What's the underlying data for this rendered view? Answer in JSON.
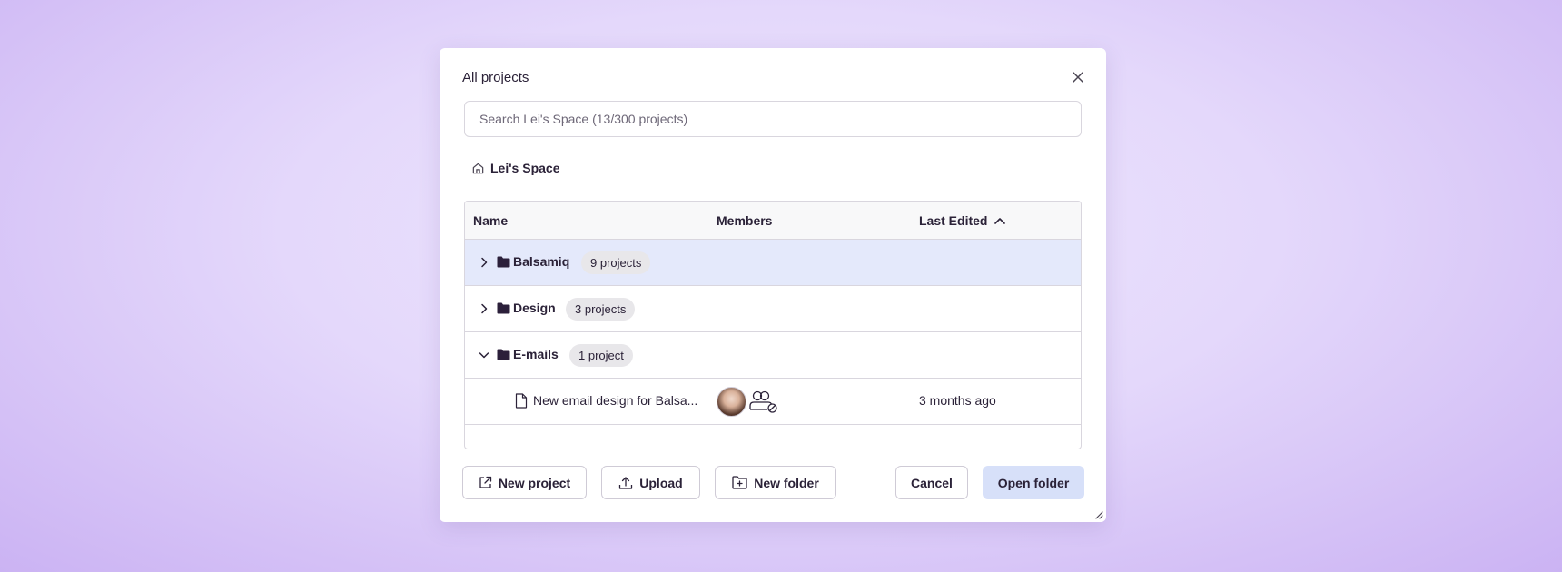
{
  "dialog": {
    "title": "All projects",
    "search_placeholder": "Search Lei's Space (13/300 projects)",
    "breadcrumb": "Lei's Space"
  },
  "table": {
    "columns": {
      "name": "Name",
      "members": "Members",
      "last_edited": "Last Edited"
    },
    "folders": [
      {
        "name": "Balsamiq",
        "count": "9 projects",
        "expanded": false,
        "selected": true
      },
      {
        "name": "Design",
        "count": "3 projects",
        "expanded": false,
        "selected": false
      },
      {
        "name": "E-mails",
        "count": "1 project",
        "expanded": true,
        "selected": false
      }
    ],
    "files": [
      {
        "name": "New email design for Balsa...",
        "last_edited": "3 months ago"
      }
    ]
  },
  "footer": {
    "new_project": "New project",
    "upload": "Upload",
    "new_folder": "New folder",
    "cancel": "Cancel",
    "open_folder": "Open folder"
  },
  "colors": {
    "selected_row": "#e4e9fb",
    "primary_button": "#d7e0f9",
    "folder_icon": "#2b1f3a"
  }
}
